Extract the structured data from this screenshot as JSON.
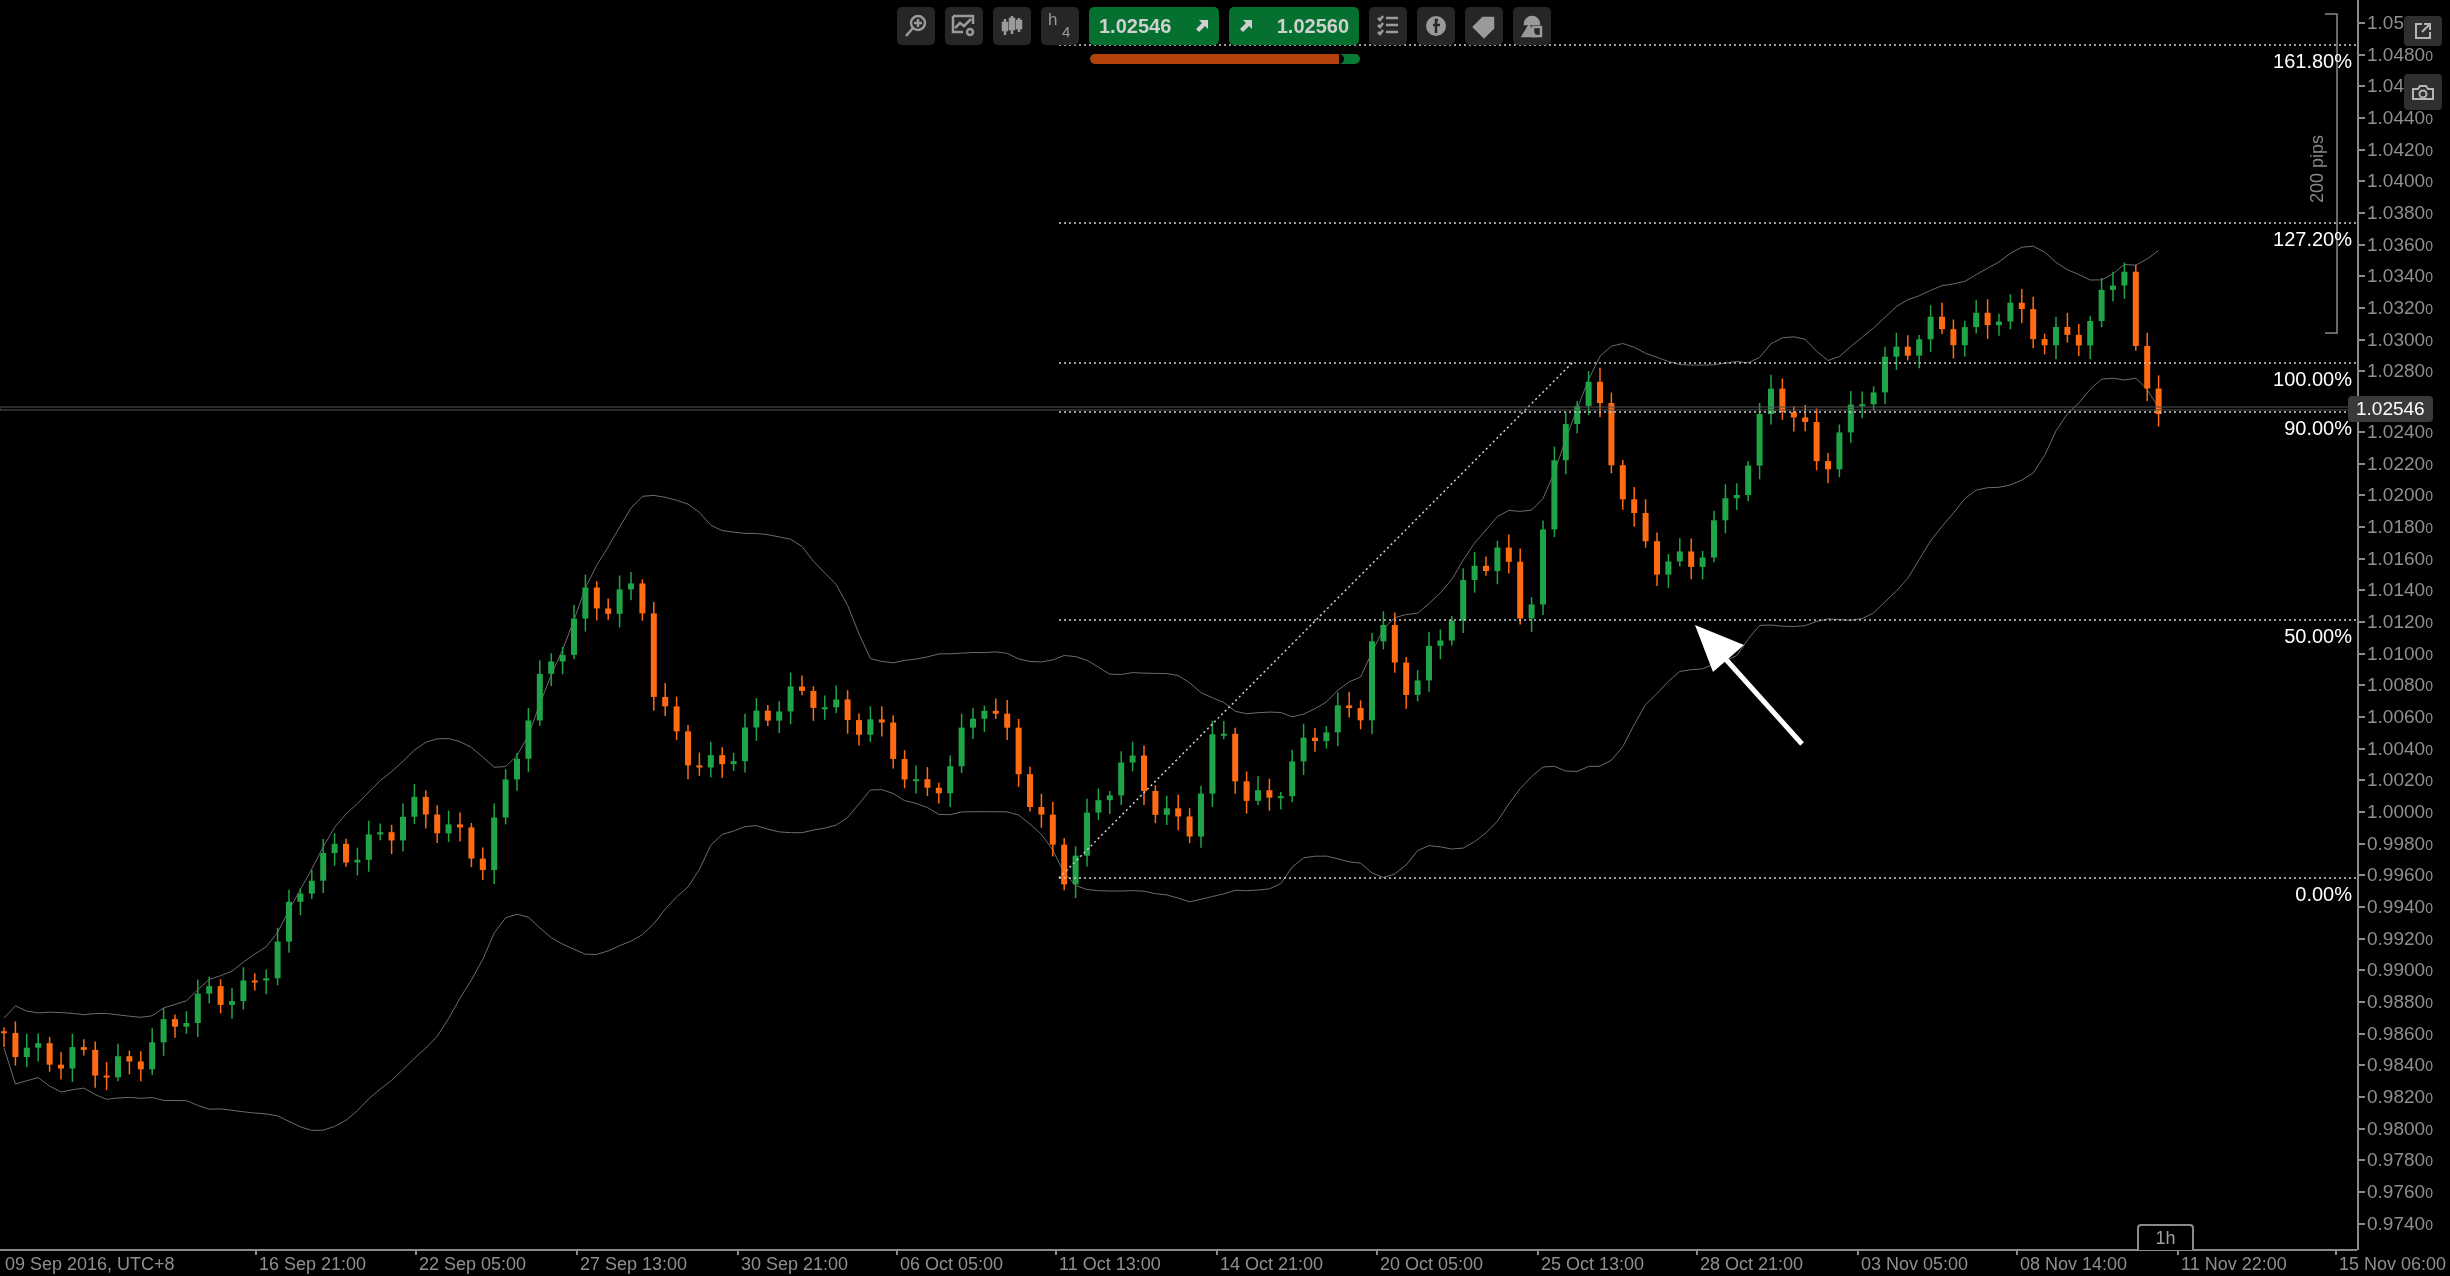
{
  "toolbar": {
    "timeframe": {
      "letter": "h",
      "number": "4"
    },
    "sell_price": "1.02546",
    "buy_price": "1.02560",
    "sentiment": {
      "level": 0.94
    }
  },
  "fibonacci_levels": [
    {
      "label": "161.80%"
    },
    {
      "label": "127.20%"
    },
    {
      "label": "100.00%"
    },
    {
      "label": "90.00%"
    },
    {
      "label": "50.00%"
    },
    {
      "label": "0.00%"
    }
  ],
  "ruler": {
    "label": "200 pips"
  },
  "current_price": "1.02546",
  "price_axis": {
    "upper": [
      {
        "main": "1.05"
      },
      {
        "main": "1.0480",
        "pip": "0"
      },
      {
        "main": "1.04"
      },
      {
        "main": "1.0440",
        "pip": "0"
      },
      {
        "main": "1.0420",
        "pip": "0"
      },
      {
        "main": "1.0400",
        "pip": "0"
      },
      {
        "main": "1.0380",
        "pip": "0"
      },
      {
        "main": "1.0360",
        "pip": "0"
      },
      {
        "main": "1.0340",
        "pip": "0"
      },
      {
        "main": "1.0320",
        "pip": "0"
      },
      {
        "main": "1.0300",
        "pip": "0"
      },
      {
        "main": "1.0280",
        "pip": "0"
      }
    ],
    "lower": [
      {
        "main": "1.0240",
        "pip": "0"
      },
      {
        "main": "1.0220",
        "pip": "0"
      },
      {
        "main": "1.0200",
        "pip": "0"
      },
      {
        "main": "1.0180",
        "pip": "0"
      },
      {
        "main": "1.0160",
        "pip": "0"
      },
      {
        "main": "1.0140",
        "pip": "0"
      },
      {
        "main": "1.0120",
        "pip": "0"
      },
      {
        "main": "1.0100",
        "pip": "0"
      },
      {
        "main": "1.0080",
        "pip": "0"
      },
      {
        "main": "1.0060",
        "pip": "0"
      },
      {
        "main": "1.0040",
        "pip": "0"
      },
      {
        "main": "1.0020",
        "pip": "0"
      },
      {
        "main": "1.0000",
        "pip": "0"
      },
      {
        "main": "0.9980",
        "pip": "0"
      },
      {
        "main": "0.9960",
        "pip": "0"
      },
      {
        "main": "0.9940",
        "pip": "0"
      },
      {
        "main": "0.9920",
        "pip": "0"
      },
      {
        "main": "0.9900",
        "pip": "0"
      },
      {
        "main": "0.9880",
        "pip": "0"
      },
      {
        "main": "0.9860",
        "pip": "0"
      },
      {
        "main": "0.9840",
        "pip": "0"
      },
      {
        "main": "0.9820",
        "pip": "0"
      },
      {
        "main": "0.9800",
        "pip": "0"
      },
      {
        "main": "0.9780",
        "pip": "0"
      },
      {
        "main": "0.9760",
        "pip": "0"
      },
      {
        "main": "0.9740",
        "pip": "0"
      }
    ]
  },
  "time_axis": [
    "09 Sep 2016, UTC+8",
    "16 Sep 21:00",
    "22 Sep 05:00",
    "27 Sep 13:00",
    "30 Sep 21:00",
    "06 Oct 05:00",
    "11 Oct 13:00",
    "14 Oct 21:00",
    "20 Oct 05:00",
    "25 Oct 13:00",
    "28 Oct 21:00",
    "03 Nov 05:00",
    "08 Nov 14:00",
    "11 Nov 22:00",
    "15 Nov 06:00"
  ],
  "period_tab": "1h"
}
